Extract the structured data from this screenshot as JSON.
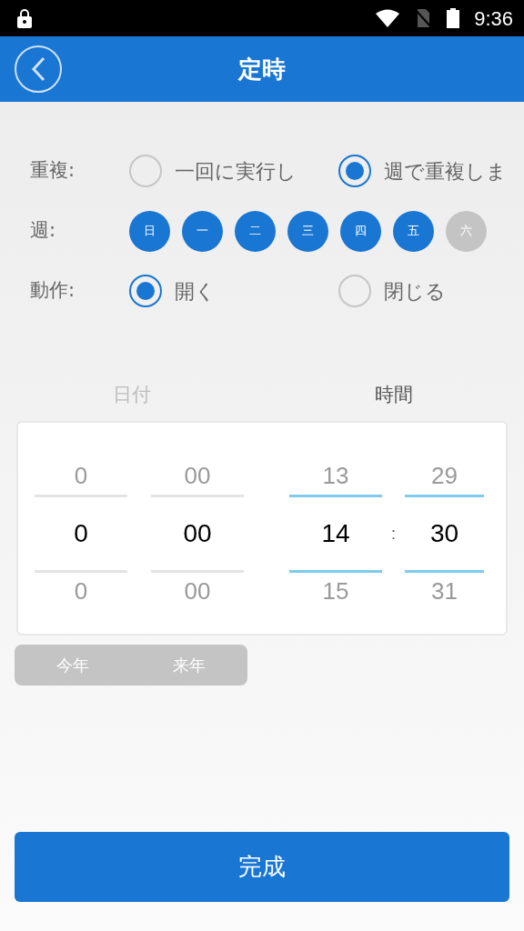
{
  "status_bar": {
    "time": "9:36"
  },
  "header": {
    "title": "定時"
  },
  "repeat": {
    "label": "重複:",
    "options": [
      {
        "label": "一回に実行し",
        "selected": false
      },
      {
        "label": "週で重複しま",
        "selected": true
      }
    ]
  },
  "week": {
    "label": "週:",
    "days": [
      {
        "label": "日",
        "selected": true
      },
      {
        "label": "一",
        "selected": true
      },
      {
        "label": "二",
        "selected": true
      },
      {
        "label": "三",
        "selected": true
      },
      {
        "label": "四",
        "selected": true
      },
      {
        "label": "五",
        "selected": true
      },
      {
        "label": "六",
        "selected": false
      }
    ]
  },
  "action": {
    "label": "動作:",
    "options": [
      {
        "label": "開く",
        "selected": true
      },
      {
        "label": "閉じる",
        "selected": false
      }
    ]
  },
  "tabs": [
    {
      "label": "日付",
      "selected": false
    },
    {
      "label": "時間",
      "selected": true
    }
  ],
  "picker": {
    "separator": ":",
    "columns": [
      {
        "highlighted": false,
        "above": "0",
        "value": "0",
        "below": "0"
      },
      {
        "highlighted": false,
        "above": "00",
        "value": "00",
        "below": "00"
      },
      {
        "highlighted": true,
        "above": "13",
        "value": "14",
        "below": "15"
      },
      {
        "highlighted": true,
        "above": "29",
        "value": "30",
        "below": "31"
      }
    ]
  },
  "year_buttons": [
    "今年",
    "来年"
  ],
  "done_button": "完成"
}
